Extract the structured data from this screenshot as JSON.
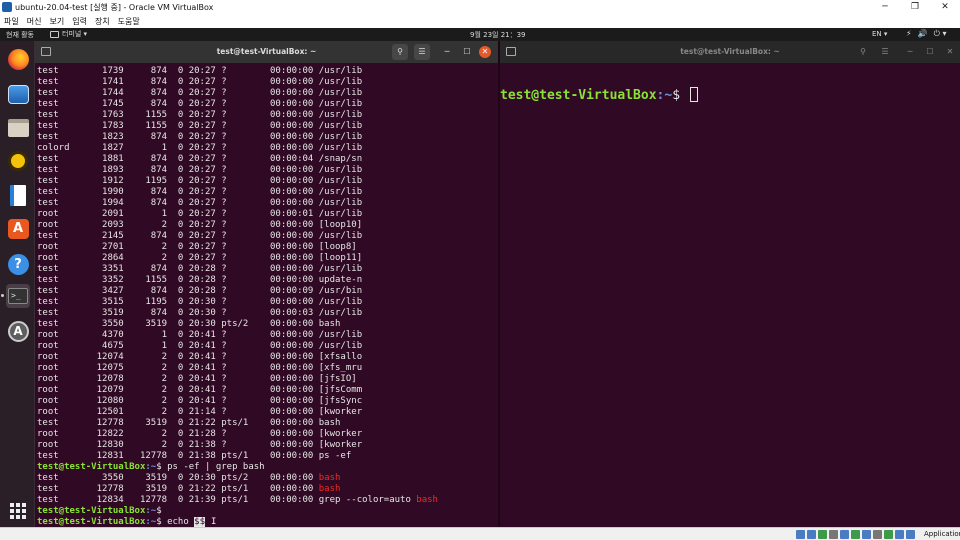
{
  "window": {
    "title": "ubuntu-20.04-test [실행 중] - Oracle VM VirtualBox",
    "controls": [
      "─",
      "❐",
      "✕"
    ]
  },
  "vbox_menu": [
    "파일",
    "머신",
    "보기",
    "입력",
    "장치",
    "도움말"
  ],
  "topbar": {
    "activities": "현재 활동",
    "app": "터미널 ▾",
    "clock": "9월 23일  21：39",
    "lang": "EN ▾",
    "tray": [
      "⚡",
      "🔊",
      "⏻ ▾"
    ]
  },
  "dock": [
    {
      "name": "firefox-icon"
    },
    {
      "name": "thunderbird-icon"
    },
    {
      "name": "files-icon"
    },
    {
      "name": "rhythmbox-icon"
    },
    {
      "name": "writer-icon"
    },
    {
      "name": "software-icon",
      "glyph": "A"
    },
    {
      "name": "help-icon",
      "glyph": "?"
    },
    {
      "name": "terminal-icon",
      "glyph": ">_"
    },
    {
      "name": "updater-icon",
      "glyph": "A"
    },
    {
      "name": "show-apps-icon"
    }
  ],
  "left_terminal": {
    "title": "test@test-VirtualBox: ~",
    "buttons": {
      "new_tab": "",
      "search": "⚲",
      "menu": "☰",
      "minimize": "─",
      "maximize": "☐",
      "close": "✕"
    },
    "ps_rows": [
      "test        1739     874  0 20:27 ?        00:00:00 /usr/lib",
      "test        1741     874  0 20:27 ?        00:00:00 /usr/lib",
      "test        1744     874  0 20:27 ?        00:00:00 /usr/lib",
      "test        1745     874  0 20:27 ?        00:00:00 /usr/lib",
      "test        1763    1155  0 20:27 ?        00:00:00 /usr/lib",
      "test        1783    1155  0 20:27 ?        00:00:00 /usr/lib",
      "test        1823     874  0 20:27 ?        00:00:00 /usr/lib",
      "colord      1827       1  0 20:27 ?        00:00:00 /usr/lib",
      "test        1881     874  0 20:27 ?        00:00:04 /snap/sn",
      "test        1893     874  0 20:27 ?        00:00:00 /usr/lib",
      "test        1912    1195  0 20:27 ?        00:00:00 /usr/lib",
      "test        1990     874  0 20:27 ?        00:00:00 /usr/lib",
      "test        1994     874  0 20:27 ?        00:00:00 /usr/lib",
      "root        2091       1  0 20:27 ?        00:00:01 /usr/lib",
      "root        2093       2  0 20:27 ?        00:00:00 [loop10]",
      "test        2145     874  0 20:27 ?        00:00:00 /usr/lib",
      "root        2701       2  0 20:27 ?        00:00:00 [loop8]",
      "root        2864       2  0 20:27 ?        00:00:00 [loop11]",
      "test        3351     874  0 20:28 ?        00:00:00 /usr/lib",
      "test        3352    1155  0 20:28 ?        00:00:00 update-n",
      "test        3427     874  0 20:28 ?        00:00:09 /usr/bin",
      "test        3515    1195  0 20:30 ?        00:00:00 /usr/lib",
      "test        3519     874  0 20:30 ?        00:00:03 /usr/lib",
      "test        3550    3519  0 20:30 pts/2    00:00:00 bash",
      "root        4370       1  0 20:41 ?        00:00:00 /usr/lib",
      "root        4675       1  0 20:41 ?        00:00:00 /usr/lib",
      "root       12074       2  0 20:41 ?        00:00:00 [xfsallo",
      "root       12075       2  0 20:41 ?        00:00:00 [xfs_mru",
      "root       12078       2  0 20:41 ?        00:00:00 [jfsIO]",
      "root       12079       2  0 20:41 ?        00:00:00 [jfsComm",
      "root       12080       2  0 20:41 ?        00:00:00 [jfsSync",
      "root       12501       2  0 21:14 ?        00:00:00 [kworker",
      "test       12778    3519  0 21:22 pts/1    00:00:00 bash",
      "root       12822       2  0 21:28 ?        00:00:00 [kworker",
      "root       12830       2  0 21:38 ?        00:00:00 [kworker",
      "test       12831   12778  0 21:38 pts/1    00:00:00 ps -ef"
    ],
    "prompt_user": "test@test-VirtualBox",
    "prompt_path": ":~",
    "prompt_sign": "$ ",
    "cmd1": "ps -ef | grep bash",
    "grep_rows": [
      {
        "pre": "test        3550    3519  0 20:30 pts/2    00:00:00 ",
        "match": "bash"
      },
      {
        "pre": "test       12778    3519  0 21:22 pts/1    00:00:00 ",
        "match": "bash"
      },
      {
        "pre": "test       12834   12778  0 21:39 pts/1    00:00:00 grep --color=auto ",
        "match": "bash"
      }
    ],
    "cmd2": "",
    "cmd3_prefix": "echo ",
    "cmd3_cursor": "$$",
    "ibeam": "I"
  },
  "right_terminal": {
    "title": "test@test-VirtualBox: ~",
    "buttons": {
      "new_tab": "",
      "search": "⚲",
      "menu": "☰",
      "minimize": "─",
      "maximize": "☐",
      "close": "✕"
    },
    "prompt_user": "test@test-VirtualBox",
    "prompt_path": ":~",
    "prompt_sign": "$ "
  },
  "statusbar": {
    "host_key": "Application"
  },
  "colors": {
    "terminal_bg": "#300a24",
    "prompt_user": "#8ae234",
    "prompt_path": "#6f8fd8",
    "grep_match": "#ef2929"
  }
}
